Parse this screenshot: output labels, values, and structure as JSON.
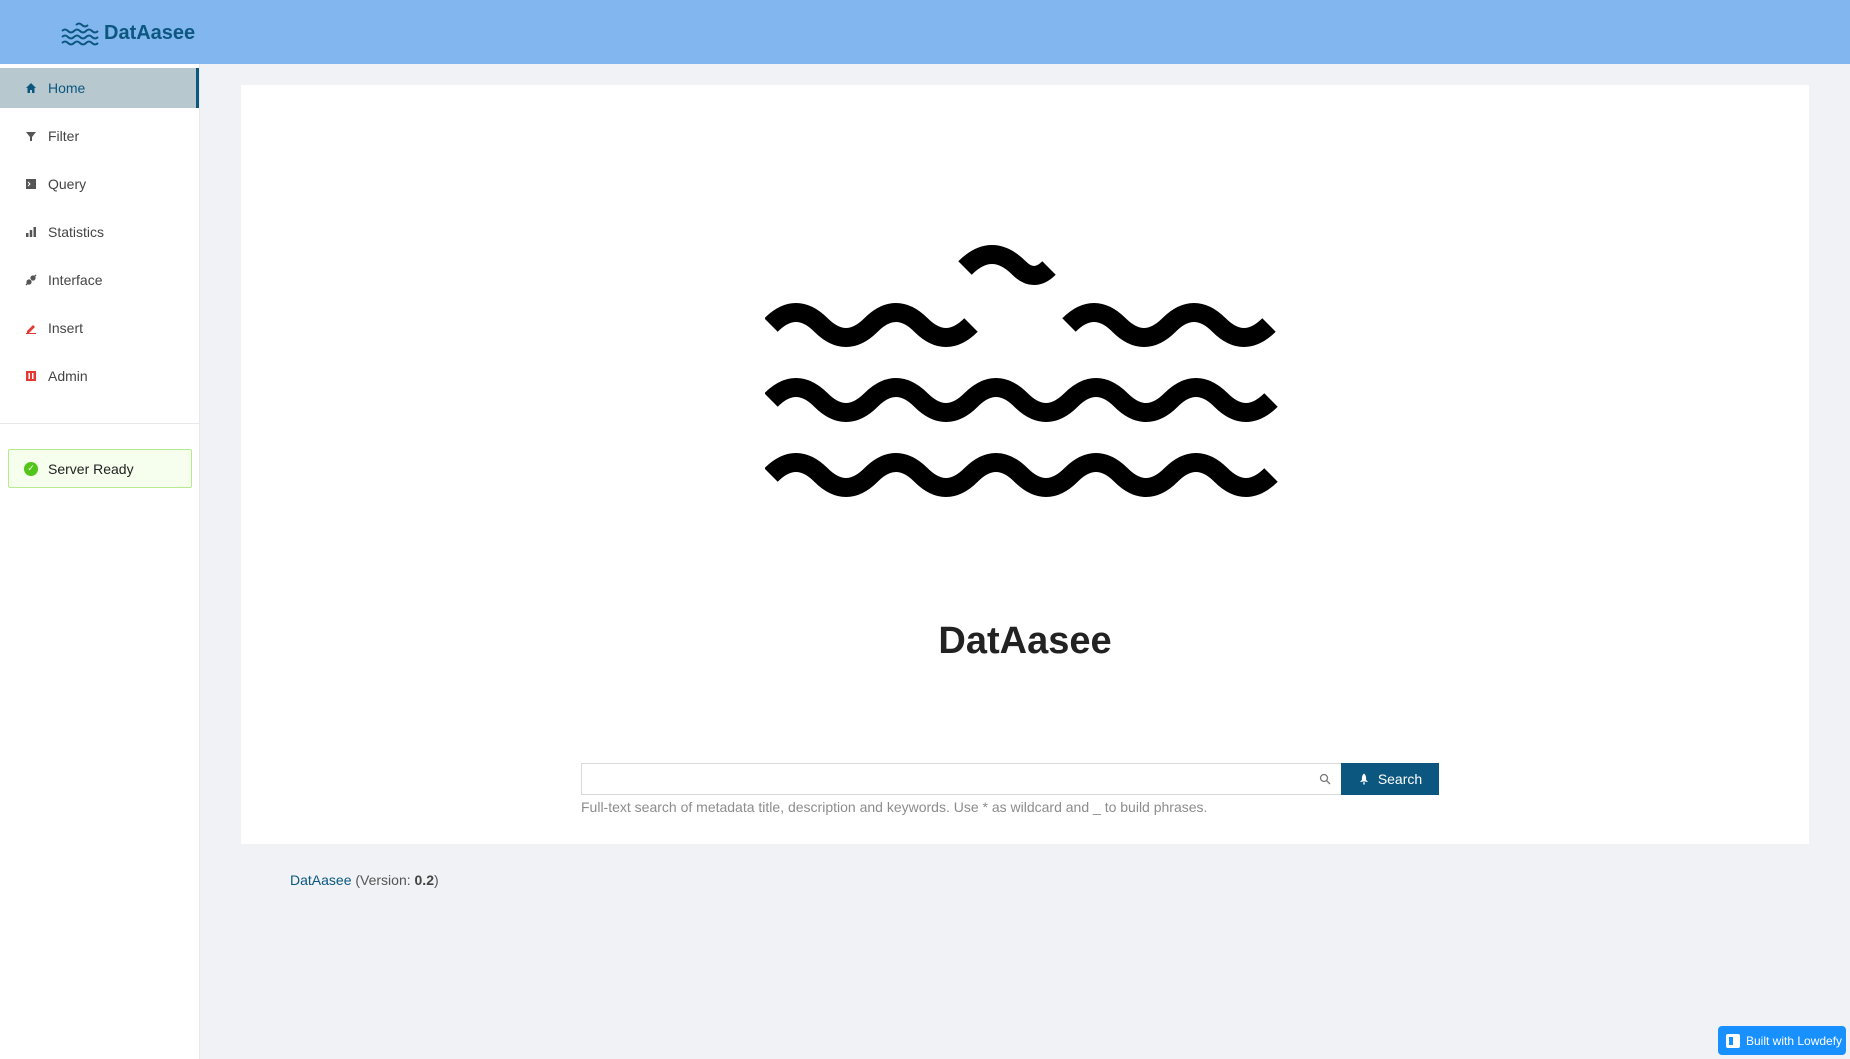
{
  "header": {
    "brand": "DatAasee"
  },
  "sidebar": {
    "items": [
      {
        "label": "Home",
        "icon": "home-icon"
      },
      {
        "label": "Filter",
        "icon": "filter-icon"
      },
      {
        "label": "Query",
        "icon": "terminal-icon"
      },
      {
        "label": "Statistics",
        "icon": "bar-chart-icon"
      },
      {
        "label": "Interface",
        "icon": "api-icon"
      },
      {
        "label": "Insert",
        "icon": "edit-icon"
      },
      {
        "label": "Admin",
        "icon": "admin-icon"
      }
    ],
    "status": "Server Ready"
  },
  "main": {
    "title": "DatAasee",
    "search": {
      "value": "",
      "placeholder": "",
      "button_label": "Search",
      "help": "Full-text search of metadata title, description and keywords. Use * as wildcard and _ to build phrases."
    }
  },
  "footer": {
    "app_link": "DatAasee",
    "version_prefix": "(Version: ",
    "version": "0.2",
    "version_suffix": ")"
  },
  "badge": {
    "label": "Built with Lowdefy"
  },
  "colors": {
    "header": "#82b6ef",
    "primary": "#0c5780",
    "success": "#52c41a",
    "lowdefy": "#1890ff"
  }
}
